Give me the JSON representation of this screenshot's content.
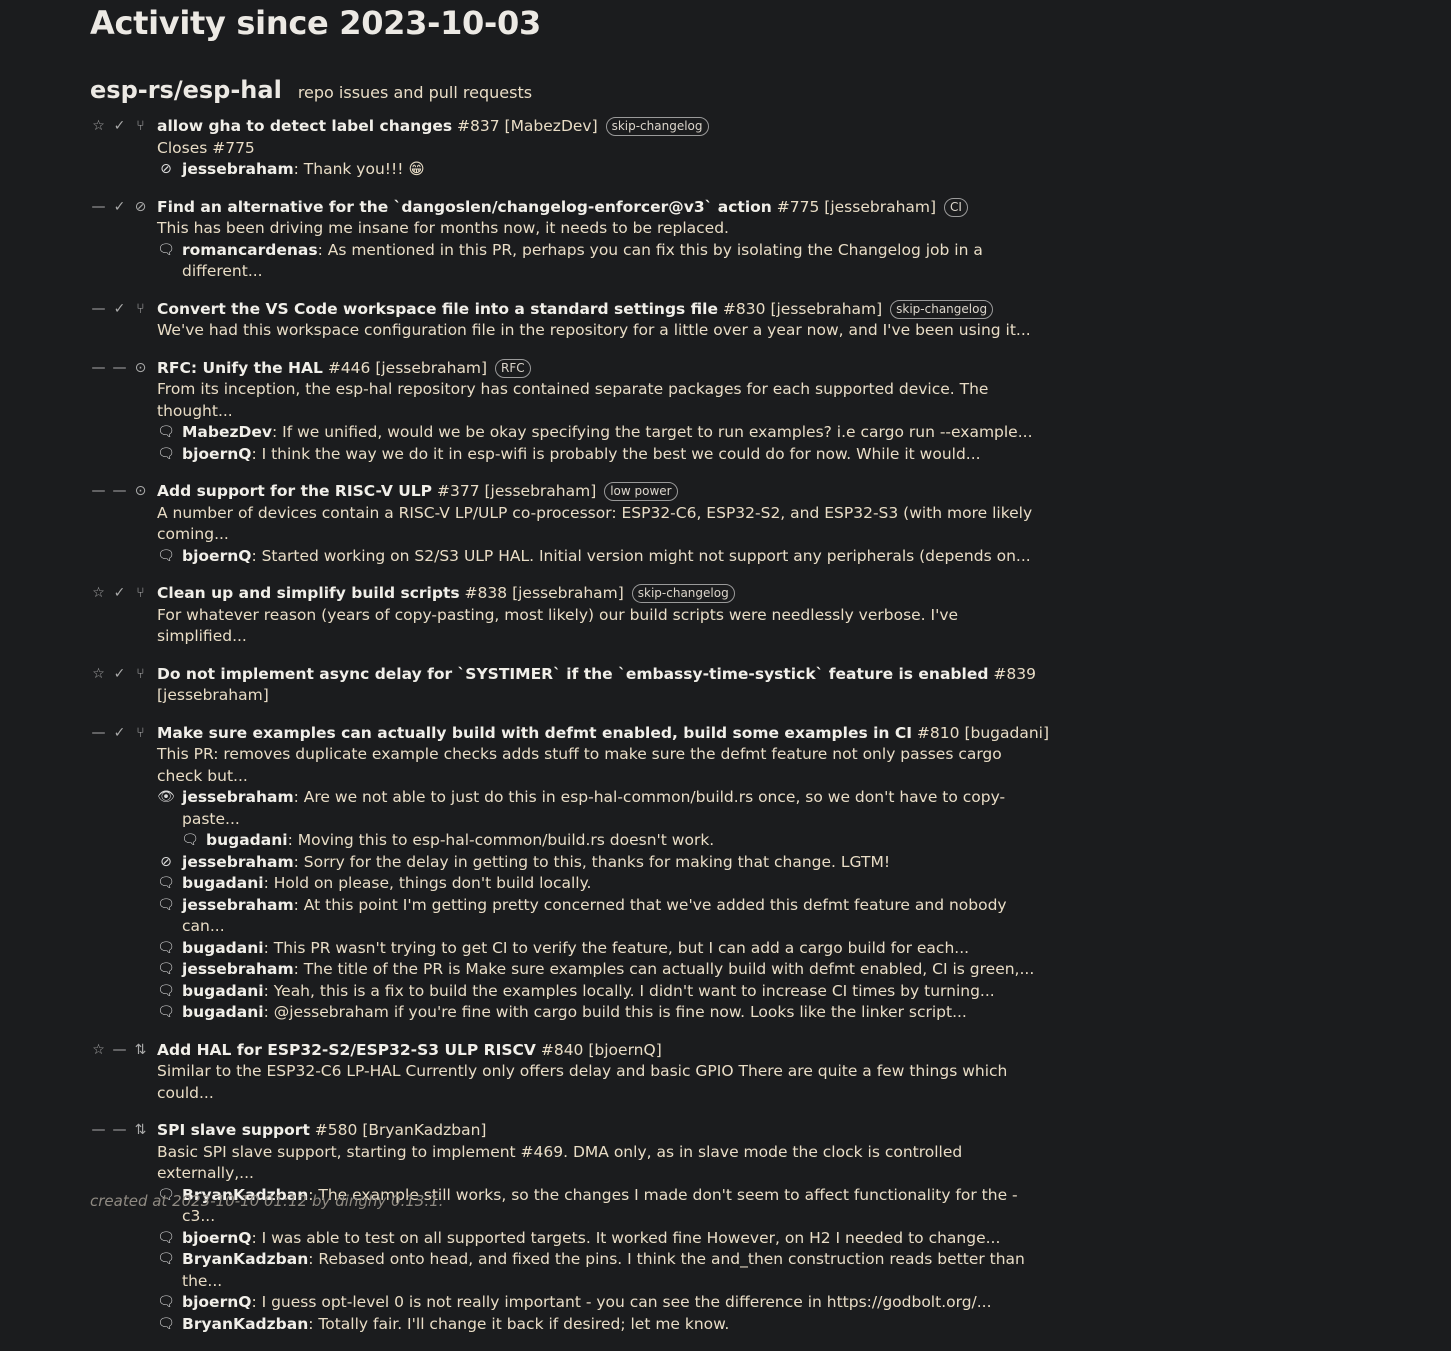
{
  "page_title": "Activity since 2023-10-03",
  "repo": {
    "name": "esp-rs/esp-hal",
    "subtitle": "repo issues and pull requests"
  },
  "icons": {
    "star": "☆",
    "dash": "—",
    "check": "✓",
    "merged": "⑂",
    "closed": "⊘",
    "open": "⊙",
    "pr": "⇅",
    "comment": "🗨",
    "review_approved": "⊘",
    "review_comment": "👁"
  },
  "items": [
    {
      "star": "star",
      "check": "check",
      "type": "merged",
      "title": "allow gha to detect label changes",
      "number": "#837",
      "author": "[MabezDev]",
      "label": "skip-changelog",
      "body": "Closes #775",
      "comments": [
        {
          "icon": "review_approved",
          "author": "jessebraham",
          "text": ": Thank you!!! 😁"
        }
      ]
    },
    {
      "star": "dash",
      "check": "check",
      "type": "closed",
      "title": "Find an alternative for the `dangoslen/changelog-enforcer@v3` action",
      "number": "#775",
      "author": "[jessebraham]",
      "label": "CI",
      "body": "This has been driving me insane for months now, it needs to be replaced.",
      "comments": [
        {
          "icon": "comment",
          "author": "romancardenas",
          "text": ": As mentioned in this PR, perhaps you can fix this by isolating the Changelog job in a different..."
        }
      ]
    },
    {
      "star": "dash",
      "check": "check",
      "type": "merged",
      "title": "Convert the VS Code workspace file into a standard settings file",
      "number": "#830",
      "author": "[jessebraham]",
      "label": "skip-changelog",
      "body": "We've had this workspace configuration file in the repository for a little over a year now, and I've been using it...",
      "comments": []
    },
    {
      "star": "dash",
      "check": "dash",
      "type": "open",
      "title": "RFC: Unify the HAL",
      "number": "#446",
      "author": "[jessebraham]",
      "label": "RFC",
      "body": "From its inception, the esp-hal repository has contained separate packages for each supported device. The thought...",
      "comments": [
        {
          "icon": "comment",
          "author": "MabezDev",
          "text": ": If we unified, would we be okay specifying the target to run examples? i.e cargo run --example..."
        },
        {
          "icon": "comment",
          "author": "bjoernQ",
          "text": ": I think the way we do it in esp-wifi is probably the best we could do for now. While it would..."
        }
      ]
    },
    {
      "star": "dash",
      "check": "dash",
      "type": "open",
      "title": "Add support for the RISC-V ULP",
      "number": "#377",
      "author": "[jessebraham]",
      "label": "low power",
      "body": "A number of devices contain a RISC-V LP/ULP co-processor: ESP32-C6, ESP32-S2, and ESP32-S3 (with more likely coming...",
      "comments": [
        {
          "icon": "comment",
          "author": "bjoernQ",
          "text": ": Started working on S2/S3 ULP HAL. Initial version might not support any peripherals (depends on..."
        }
      ]
    },
    {
      "star": "star",
      "check": "check",
      "type": "merged",
      "title": "Clean up and simplify build scripts",
      "number": "#838",
      "author": "[jessebraham]",
      "label": "skip-changelog",
      "body": "For whatever reason (years of copy-pasting, most likely) our build scripts were needlessly verbose. I've simplified...",
      "comments": []
    },
    {
      "star": "star",
      "check": "check",
      "type": "merged",
      "title": "Do not implement async delay for `SYSTIMER` if the `embassy-time-systick` feature is enabled",
      "number": "#839",
      "author": "[jessebraham]",
      "label": "",
      "body": "",
      "comments": []
    },
    {
      "star": "dash",
      "check": "check",
      "type": "merged",
      "title": "Make sure examples can actually build with defmt enabled, build some examples in CI",
      "number": "#810",
      "author": "[bugadani]",
      "label": "",
      "body": "This PR: removes duplicate example checks adds stuff to make sure the defmt feature not only passes cargo check but...",
      "comments": [
        {
          "icon": "review_comment",
          "author": "jessebraham",
          "text": ": Are we not able to just do this in esp-hal-common/build.rs once, so we don't have to copy-paste..."
        },
        {
          "icon": "comment",
          "author": "bugadani",
          "text": ": Moving this to esp-hal-common/build.rs doesn't work.",
          "indent": true
        },
        {
          "icon": "review_approved",
          "author": "jessebraham",
          "text": ": Sorry for the delay in getting to this, thanks for making that change. LGTM!"
        },
        {
          "icon": "comment",
          "author": "bugadani",
          "text": ": Hold on please, things don't build locally."
        },
        {
          "icon": "comment",
          "author": "jessebraham",
          "text": ": At this point I'm getting pretty concerned that we've added this defmt feature and nobody can..."
        },
        {
          "icon": "comment",
          "author": "bugadani",
          "text": ": This PR wasn't trying to get CI to verify the feature, but I can add a cargo build for each..."
        },
        {
          "icon": "comment",
          "author": "jessebraham",
          "text": ": The title of the PR is Make sure examples can actually build with defmt enabled, CI is green,..."
        },
        {
          "icon": "comment",
          "author": "bugadani",
          "text": ": Yeah, this is a fix to build the examples locally. I didn't want to increase CI times by turning..."
        },
        {
          "icon": "comment",
          "author": "bugadani",
          "text": ": @jessebraham if you're fine with cargo build this is fine now. Looks like the linker script..."
        }
      ]
    },
    {
      "star": "star",
      "check": "dash",
      "type": "pr",
      "title": "Add HAL for ESP32-S2/ESP32-S3 ULP RISCV",
      "number": "#840",
      "author": "[bjoernQ]",
      "label": "",
      "body": "Similar to the ESP32-C6 LP-HAL Currently only offers delay and basic GPIO There are quite a few things which could...",
      "comments": []
    },
    {
      "star": "dash",
      "check": "dash",
      "type": "pr",
      "title": "SPI slave support",
      "number": "#580",
      "author": "[BryanKadzban]",
      "label": "",
      "body": "Basic SPI slave support, starting to implement #469. DMA only, as in slave mode the clock is controlled externally,...",
      "comments": [
        {
          "icon": "comment",
          "author": "BryanKadzban",
          "text": ": The example still works, so the changes I made don't seem to affect functionality for the -c3..."
        },
        {
          "icon": "comment",
          "author": "bjoernQ",
          "text": ": I was able to test on all supported targets. It worked fine However, on H2 I needed to change..."
        },
        {
          "icon": "comment",
          "author": "BryanKadzban",
          "text": ": Rebased onto head, and fixed the pins. I think the and_then construction reads better than the..."
        },
        {
          "icon": "comment",
          "author": "bjoernQ",
          "text": ": I guess opt-level 0 is not really important - you can see the difference in https://godbolt.org/..."
        },
        {
          "icon": "comment",
          "author": "BryanKadzban",
          "text": ": Totally fair. I'll change it back if desired; let me know."
        }
      ]
    }
  ],
  "footer": "created at 2023-10-10 01:12 by dinghy 0.13.1."
}
